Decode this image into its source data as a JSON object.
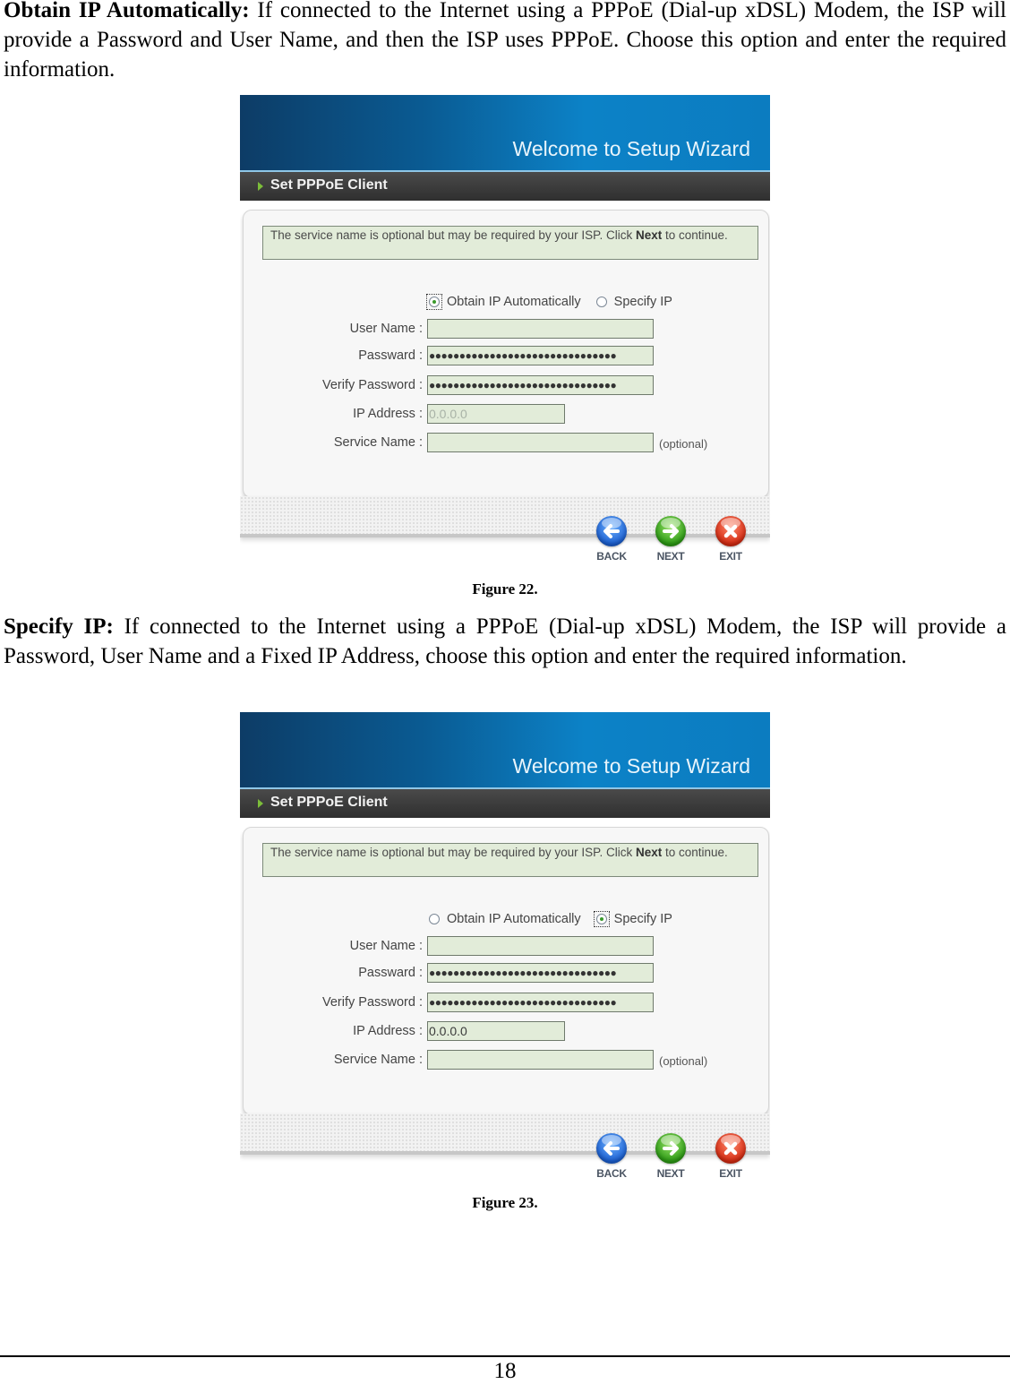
{
  "paragraphs": [
    {
      "lead": "Obtain IP Automatically:",
      "text": " If connected to the Internet using a PPPoE (Dial-up xDSL) Modem, the ISP will provide a Password and User Name, and then the ISP uses PPPoE. Choose this option and enter the required information."
    },
    {
      "lead": "Specify IP:",
      "text": " If connected to the Internet using a PPPoE (Dial-up xDSL) Modem, the ISP will provide a Password, User Name and a Fixed IP Address, choose this option and enter the required information."
    }
  ],
  "figures": [
    {
      "caption": "Figure 22.",
      "banner_title": "Welcome to Setup Wizard",
      "section_title": "Set PPPoE Client",
      "note": {
        "before": "The service name is optional but may be required by your ISP. Click ",
        "bold": "Next",
        "after": " to continue."
      },
      "radio_options": [
        {
          "label": "Obtain IP Automatically",
          "checked": true
        },
        {
          "label": "Specify IP",
          "checked": false
        }
      ],
      "fields": {
        "user_name": {
          "label": "User Name :",
          "value": ""
        },
        "password": {
          "label": "Passward :",
          "value": "●●●●●●●●●●●●●●●●●●●●●●●●●●●●●●●"
        },
        "verify_password": {
          "label": "Verify Password :",
          "value": "●●●●●●●●●●●●●●●●●●●●●●●●●●●●●●●"
        },
        "ip_address": {
          "label": "IP Address :",
          "value": "0.0.0.0",
          "disabled": true
        },
        "service_name": {
          "label": "Service Name :",
          "value": "",
          "hint": "(optional)"
        }
      },
      "buttons": {
        "back": "BACK",
        "next": "NEXT",
        "exit": "EXIT"
      }
    },
    {
      "caption": "Figure 23.",
      "banner_title": "Welcome to Setup Wizard",
      "section_title": "Set PPPoE Client",
      "note": {
        "before": "The service name is optional but may be required by your ISP. Click ",
        "bold": "Next",
        "after": " to continue."
      },
      "radio_options": [
        {
          "label": "Obtain IP Automatically",
          "checked": false
        },
        {
          "label": "Specify IP",
          "checked": true
        }
      ],
      "fields": {
        "user_name": {
          "label": "User Name :",
          "value": ""
        },
        "password": {
          "label": "Passward :",
          "value": "●●●●●●●●●●●●●●●●●●●●●●●●●●●●●●●"
        },
        "verify_password": {
          "label": "Verify Password :",
          "value": "●●●●●●●●●●●●●●●●●●●●●●●●●●●●●●●"
        },
        "ip_address": {
          "label": "IP Address :",
          "value": "0.0.0.0",
          "disabled": false
        },
        "service_name": {
          "label": "Service Name :",
          "value": "",
          "hint": "(optional)"
        }
      },
      "buttons": {
        "back": "BACK",
        "next": "NEXT",
        "exit": "EXIT"
      }
    }
  ],
  "colors": {
    "banner_blue": "#0c82c7",
    "section_bar": "#3a3a3a",
    "field_bg": "#e2ecd9",
    "back_blue": "#1b5fd1",
    "next_green": "#2c9a14",
    "exit_red": "#d42b12"
  },
  "footer": {
    "page_number": "18"
  }
}
